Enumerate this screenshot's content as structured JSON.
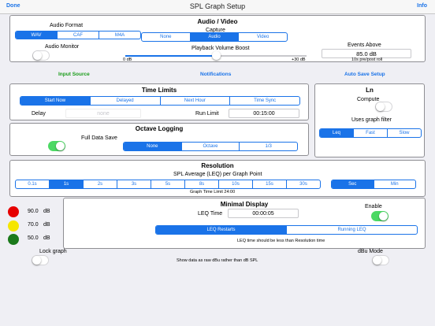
{
  "nav": {
    "done": "Done",
    "title": "SPL Graph Setup",
    "info": "Info"
  },
  "audio": {
    "title": "Audio / Video",
    "format_label": "Audio Format",
    "formats": [
      "WAV",
      "CAF",
      "M4A"
    ],
    "capture_label": "Capture",
    "captures": [
      "None",
      "Audio",
      "Video"
    ],
    "monitor_label": "Audio Monitor",
    "boost_label": "Playback Volume Boost",
    "boost_min": "0 dB",
    "boost_max": "+30 dB",
    "boost_level": 0.5,
    "events_label": "Events Above",
    "events_value": "85.0 dB",
    "events_note": "10s pre/post roll"
  },
  "links": {
    "input_source": "Input Source",
    "notifications": "Notifications",
    "auto_save": "Auto Save Setup"
  },
  "time_limits": {
    "title": "Time Limits",
    "starts": [
      "Start Now",
      "Delayed",
      "Next Hour",
      "Time Sync"
    ],
    "delay_label": "Delay",
    "delay_placeholder": "none",
    "run_limit_label": "Run Limit",
    "run_limit_value": "00:15:00"
  },
  "ln": {
    "title": "Ln",
    "compute_label": "Compute",
    "filter_label": "Uses graph filter",
    "filters": [
      "Leq",
      "Fast",
      "Slow"
    ]
  },
  "octave": {
    "title": "Octave Logging",
    "full_save_label": "Full Data Save",
    "modes": [
      "None",
      "Octave",
      "1/3"
    ]
  },
  "resolution": {
    "title": "Resolution",
    "subtitle": "SPL Average (LEQ) per Graph Point",
    "values": [
      "0.1s",
      "1s",
      "2s",
      "3s",
      "5s",
      "8s",
      "10s",
      "15s",
      "30s"
    ],
    "units": [
      "Sec",
      "Min"
    ],
    "graph_time": "Graph Time Limit 24:00"
  },
  "thresholds": [
    {
      "value": "90.0",
      "unit": "dB",
      "color": "#e60000"
    },
    {
      "value": "70.0",
      "unit": "dB",
      "color": "#f5e600"
    },
    {
      "value": "50.0",
      "unit": "dB",
      "color": "#1b7a1b"
    }
  ],
  "minimal": {
    "title": "Minimal Display",
    "leq_time_label": "LEQ Time",
    "leq_time_value": "00:00:05",
    "enable_label": "Enable",
    "modes": [
      "LEQ Restarts",
      "Running LEQ"
    ],
    "note": "LEQ time should be less than Resolution time"
  },
  "bottom": {
    "lock_label": "Lock graph",
    "raw_note": "Show data as raw dBu rather than dB SPL",
    "dbu_label": "dBu Mode"
  }
}
